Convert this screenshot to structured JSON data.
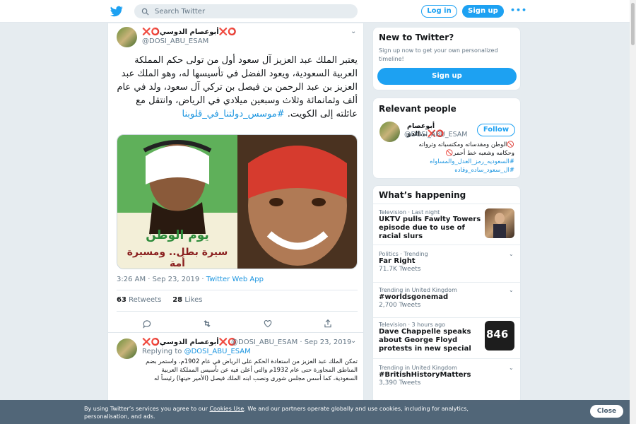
{
  "header": {
    "search_placeholder": "Search Twitter",
    "login_label": "Log in",
    "signup_label": "Sign up",
    "more_label": "•••"
  },
  "tweet": {
    "name": "❌⭕أبوعصام الدوسي❌⭕",
    "handle": "@DOSI_ABU_ESAM",
    "text": "يعتبر الملك عبد العزيز آل سعود أول من تولى حكم المملكة العربية السعودية، ويعود الفضل في تأسيسها له، وهو الملك عبد العزيز بن عبد الرحمن بن فيصل بن تركي آل سعود، ولد في عام ألف وثمانمائة وثلاث وسبعين ميلادي في الرياض، وانتقل مع عائلته إلى الكويت.",
    "hashtag": "#موسس_دولتنا_في_قلوبنا",
    "media_caption_1": "يوم الوطن",
    "media_caption_2": "سيرة بطل.. ومسيرة أمة",
    "time": "3:26 AM · Sep 23, 2019 · ",
    "client": "Twitter Web App",
    "retweets_count": "63",
    "retweets_label": "Retweets",
    "likes_count": "28",
    "likes_label": "Likes"
  },
  "reply": {
    "name": "❌⭕أبوعصام الدوسي❌⭕",
    "handle_date": "@DOSI_ABU_ESAM · Sep 23, 2019",
    "replying_prefix": "Replying to ",
    "replying_handle": "@DOSI_ABU_ESAM",
    "text": "تمكن الملك عبد العزيز من استعادة الحكم على الرياض في عام 1902م، واستمر بضم المناطق المجاورة حتى عام 1932م والتي أعلن فيه عن تأسيس المملكة العربية السعودية، كما أسس مجلس شورى ونصب ابنه الملك فيصل (الأمير حينها) رئيساً له"
  },
  "new_to_twitter": {
    "title": "New to Twitter?",
    "subtitle": "Sign up now to get your own personalized timeline!",
    "button": "Sign up"
  },
  "relevant": {
    "title": "Relevant people",
    "name": "أبوعصام الدو...❌⭕",
    "handle": "@DOSI_ABU_ESAM",
    "follow": "Follow",
    "bio1": "🚫الوطن ومقدساته ومكتسباته وثرواته",
    "bio2": "وحكامه وشعبه خط أحمر🚫",
    "bio3": "#السعوديه_رمز_العدل_والمساواه",
    "bio4": "#ال_سعود_ساده_وقاده"
  },
  "happening": {
    "title": "What’s happening",
    "trends": [
      {
        "ctx": "Television · Last night",
        "title": "UKTV pulls Fawlty Towers episode due to use of racial slurs",
        "count": ""
      },
      {
        "ctx": "Politics · Trending",
        "title": "Far Right",
        "count": "71.7K Tweets"
      },
      {
        "ctx": "Trending in United Kingdom",
        "title": "#worldsgonemad",
        "count": "2,700 Tweets"
      },
      {
        "ctx": "Television · 3 hours ago",
        "title": "Dave Chappelle speaks about George Floyd protests in new special",
        "count": ""
      },
      {
        "ctx": "Trending in United Kingdom",
        "title": "#BritishHistoryMatters",
        "count": "3,390 Tweets"
      }
    ],
    "badge_46": "846"
  },
  "cookie": {
    "text_before": "By using Twitter’s services you agree to our ",
    "link": "Cookies Use",
    "text_after": ". We and our partners operate globally and use cookies, including for analytics, personalisation, and ads.",
    "close": "Close"
  }
}
